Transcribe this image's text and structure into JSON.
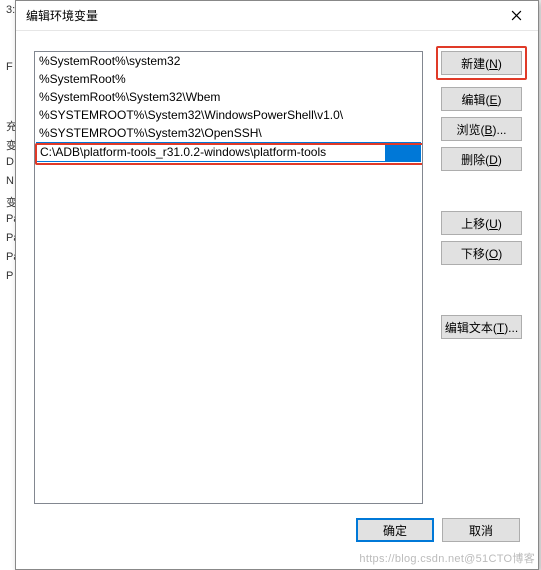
{
  "bg_fragments": [
    "3:",
    "",
    "",
    "F",
    "",
    "",
    "充",
    "变",
    "D",
    "N",
    "变",
    "Pa",
    "Pa",
    "Pa",
    "P"
  ],
  "dialog": {
    "title": "编辑环境变量",
    "close_icon": "close"
  },
  "list": {
    "items": [
      "%SystemRoot%\\system32",
      "%SystemRoot%",
      "%SystemRoot%\\System32\\Wbem",
      "%SYSTEMROOT%\\System32\\WindowsPowerShell\\v1.0\\",
      "%SYSTEMROOT%\\System32\\OpenSSH\\"
    ],
    "editing_value": "C:\\ADB\\platform-tools_r31.0.2-windows\\platform-tools"
  },
  "buttons": {
    "new": "新建(N)",
    "edit": "编辑(E)",
    "browse": "浏览(B)...",
    "delete": "删除(D)",
    "moveup": "上移(U)",
    "movedown": "下移(O)",
    "edittext": "编辑文本(T)..."
  },
  "footer": {
    "ok": "确定",
    "cancel": "取消"
  },
  "watermark": "https://blog.csdn.net@51CTO博客"
}
